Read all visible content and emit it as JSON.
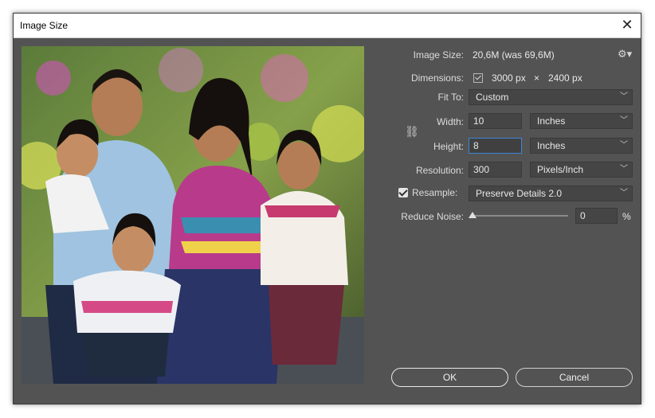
{
  "window": {
    "title": "Image Size",
    "close_label": "✕"
  },
  "info": {
    "image_size_label": "Image Size:",
    "image_size_value": "20,6M (was 69,6M)",
    "dimensions_label": "Dimensions:",
    "dimensions_width": "3000 px",
    "dimensions_sep": "×",
    "dimensions_height": "2400 px"
  },
  "fit_to": {
    "label": "Fit To:",
    "value": "Custom"
  },
  "width": {
    "label": "Width:",
    "value": "10",
    "unit": "Inches"
  },
  "height": {
    "label": "Height:",
    "value": "8",
    "unit": "Inches"
  },
  "resolution": {
    "label": "Resolution:",
    "value": "300",
    "unit": "Pixels/Inch"
  },
  "resample": {
    "label": "Resample:",
    "checked": true,
    "value": "Preserve Details 2.0"
  },
  "reduce_noise": {
    "label": "Reduce Noise:",
    "value": "0",
    "percent": "%",
    "level": 0
  },
  "buttons": {
    "ok": "OK",
    "cancel": "Cancel"
  },
  "icons": {
    "gear": "gear-icon",
    "link": "link-icon",
    "chevron": "chevron-down-icon"
  }
}
